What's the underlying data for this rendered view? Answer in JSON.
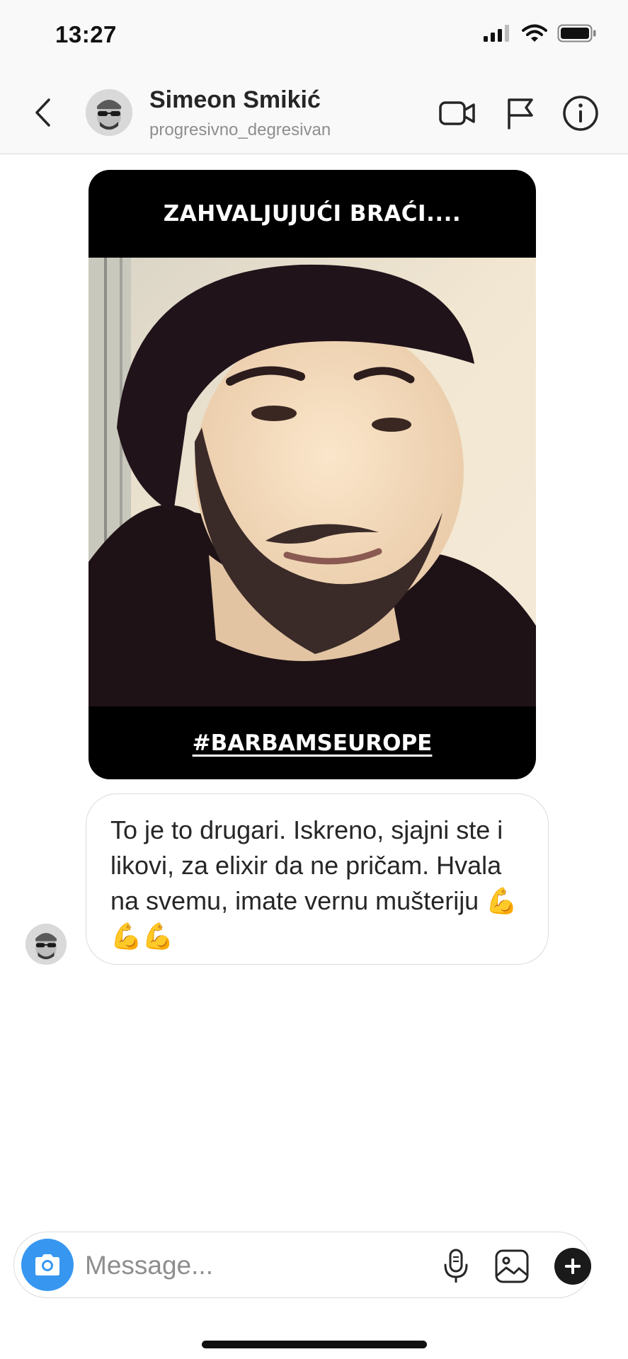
{
  "status_bar": {
    "time": "13:27",
    "icons": [
      "signal-icon",
      "wifi-icon",
      "battery-icon"
    ]
  },
  "header": {
    "title": "Simeon Smikić",
    "subtitle": "progresivno_degresivan",
    "icons": [
      "back-icon",
      "video-call-icon",
      "flag-icon",
      "info-icon"
    ]
  },
  "story": {
    "top_caption": "ZAHVALJUJUĆI BRAĆI....",
    "bottom_tag": "#BARBAMSEUROPE"
  },
  "message": {
    "text": "To je to drugari. Iskreno, sjajni ste i likovi, za elixir da ne pričam. Hvala na svemu, imate vernu mušteriju 💪💪💪"
  },
  "composer": {
    "placeholder": "Message...",
    "icons": [
      "camera-icon",
      "microphone-icon",
      "gallery-icon",
      "plus-icon"
    ]
  },
  "colors": {
    "accent": "#3797f0",
    "border": "#dbdbdb",
    "secondary_text": "#8e8e8e"
  }
}
